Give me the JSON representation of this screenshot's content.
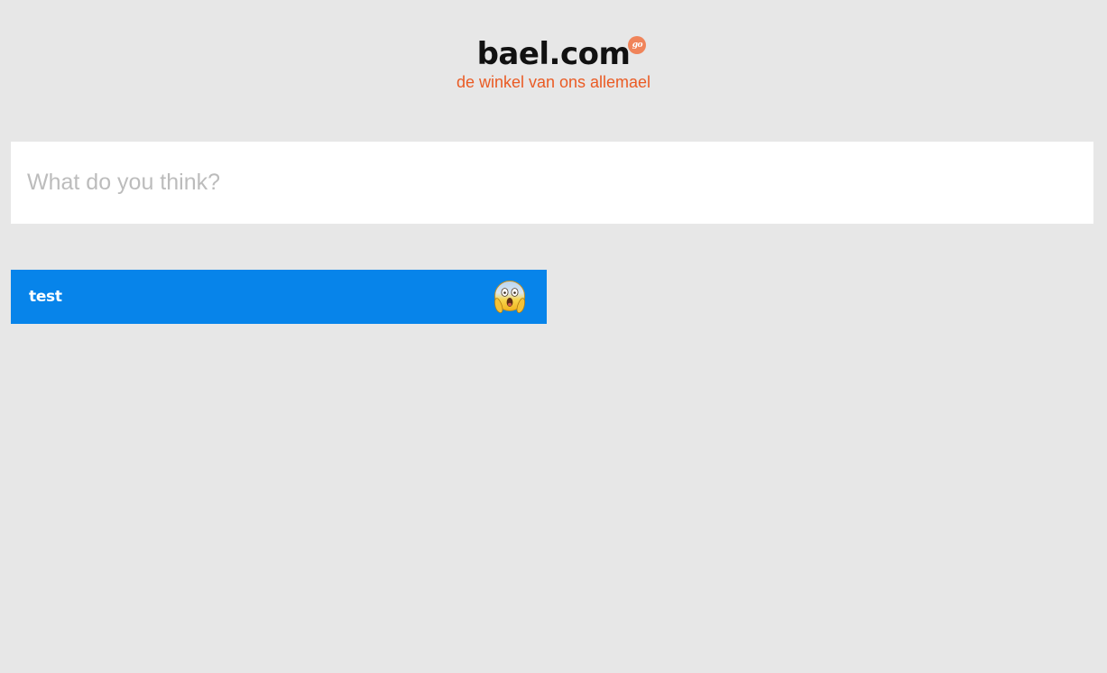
{
  "header": {
    "logo_text": "bael.com",
    "logo_badge": "go",
    "tagline": "de winkel van ons allemael"
  },
  "feedback": {
    "placeholder": "What do you think?",
    "value": ""
  },
  "items": [
    {
      "label": "test",
      "icon": "face-screaming-in-fear-emoji",
      "color": "#0784ea"
    }
  ],
  "colors": {
    "background": "#e7e7e7",
    "accent_orange": "#ea5b24",
    "card_blue": "#0784ea"
  }
}
